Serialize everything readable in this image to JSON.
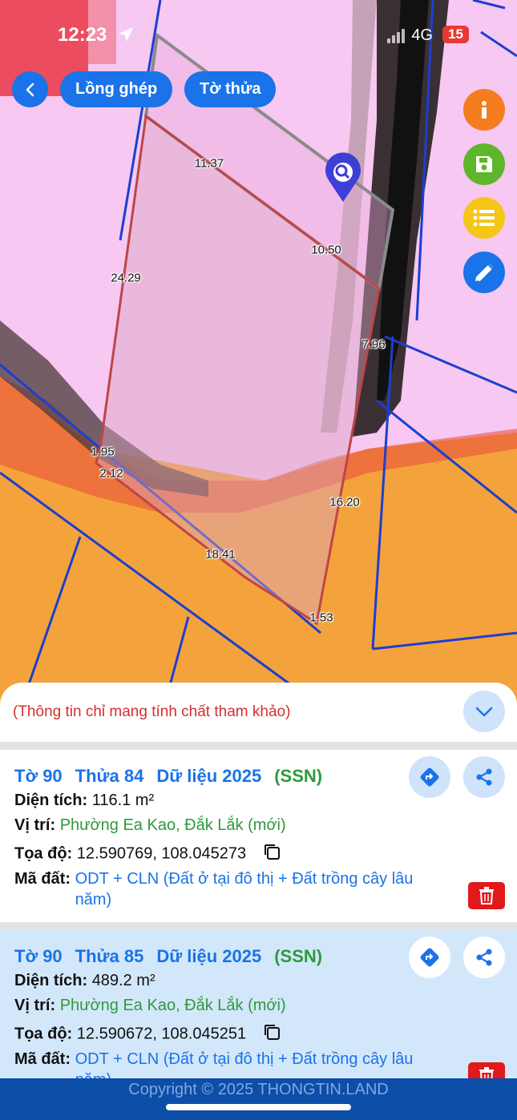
{
  "status_bar": {
    "time": "12:23",
    "network": "4G",
    "battery": "15"
  },
  "map": {
    "top_buttons": {
      "overlay_label": "Lồng ghép",
      "sheet_label": "Tờ thửa"
    },
    "segment_labels": [
      "11.37",
      "10.50",
      "24.29",
      "7.96",
      "1.95",
      "2.12",
      "16.20",
      "18.41",
      "1.53"
    ]
  },
  "panel": {
    "notice": "(Thông tin chỉ mang tính chất tham khảo)",
    "parcels": [
      {
        "sheet": "Tờ 90",
        "plot": "Thửa 84",
        "data_year": "Dữ liệu 2025",
        "source": "(SSN)",
        "area_label": "Diện tích:",
        "area_value": "116.1 m²",
        "location_label": "Vị trí:",
        "location_value": "Phường Ea Kao, Đắk Lắk (mới)",
        "coords_label": "Tọa độ:",
        "coords_value": "12.590769, 108.045273",
        "code_label": "Mã đất:",
        "code_value": "ODT + CLN (Đất ở tại đô thị + Đất trồng cây lâu năm)"
      },
      {
        "sheet": "Tờ 90",
        "plot": "Thửa 85",
        "data_year": "Dữ liệu 2025",
        "source": "(SSN)",
        "area_label": "Diện tích:",
        "area_value": "489.2 m²",
        "location_label": "Vị trí:",
        "location_value": "Phường Ea Kao, Đắk Lắk (mới)",
        "coords_label": "Tọa độ:",
        "coords_value": "12.590672, 108.045251",
        "code_label": "Mã đất:",
        "code_value": "ODT + CLN (Đất ở tại đô thị + Đất trồng cây lâu năm)"
      }
    ]
  },
  "footer": {
    "copyright": "Copyright © 2025 THONGTIN.LAND"
  },
  "colors": {
    "primary": "#1a73e8",
    "info_button": "#f57c1f",
    "save_button": "#5fb52c",
    "list_button": "#f5c518",
    "warning_text": "#d32f2f",
    "green_text": "#2e9a3a",
    "footer": "#0c4ea8"
  },
  "icons": [
    "arrow-left-icon",
    "search-location-pin-icon",
    "info-icon",
    "save-icon",
    "list-icon",
    "measure-icon",
    "chevron-down-icon",
    "directions-icon",
    "share-icon",
    "copy-icon",
    "trash-icon",
    "location-arrow-icon"
  ]
}
